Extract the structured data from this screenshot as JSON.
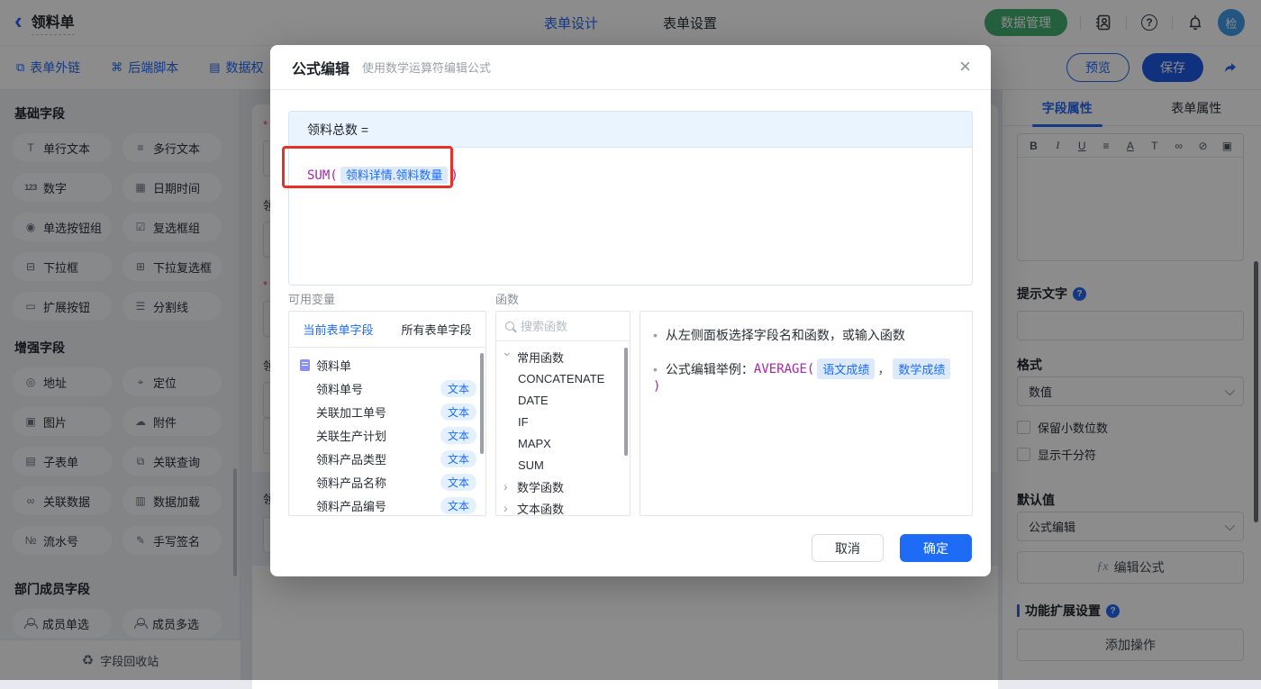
{
  "colors": {
    "accent_blue": "#2468f2",
    "brand_green": "#43ad72",
    "function_purple": "#a626a4",
    "annotation_red": "#e8302a",
    "chip_text": "#1c6cff",
    "chip_bg": "#dceafb"
  },
  "topbar": {
    "back": "‹",
    "title": "领料单",
    "tabs": [
      {
        "label": "表单设计"
      },
      {
        "label": "表单设置"
      }
    ],
    "data_manage_label": "数据管理",
    "help_glyph": "?",
    "avatar_text": "检"
  },
  "subbar": {
    "items": [
      {
        "label": "表单外链",
        "icon": "⧉"
      },
      {
        "label": "后端脚本",
        "icon": "⌘"
      },
      {
        "label": "数据权",
        "icon": "▤"
      }
    ],
    "preview_label": "预览",
    "save_label": "保存"
  },
  "sidebar": {
    "sections": [
      {
        "title": "基础字段",
        "fields": [
          {
            "label": "单行文本",
            "icon": "T"
          },
          {
            "label": "多行文本",
            "icon": "≡"
          },
          {
            "label": "数字",
            "icon": "123"
          },
          {
            "label": "日期时间",
            "icon": "▦"
          },
          {
            "label": "单选按钮组",
            "icon": "◉"
          },
          {
            "label": "复选框组",
            "icon": "☑"
          },
          {
            "label": "下拉框",
            "icon": "⊟"
          },
          {
            "label": "下拉复选框",
            "icon": "⊞"
          },
          {
            "label": "扩展按钮",
            "icon": "▭"
          },
          {
            "label": "分割线",
            "icon": "☰"
          }
        ]
      },
      {
        "title": "增强字段",
        "fields": [
          {
            "label": "地址",
            "icon": "◎"
          },
          {
            "label": "定位",
            "icon": "⌖"
          },
          {
            "label": "图片",
            "icon": "▣"
          },
          {
            "label": "附件",
            "icon": "☁"
          },
          {
            "label": "子表单",
            "icon": "▤"
          },
          {
            "label": "关联查询",
            "icon": "⧉"
          },
          {
            "label": "关联数据",
            "icon": "∞"
          },
          {
            "label": "数据加载",
            "icon": "▥"
          },
          {
            "label": "流水号",
            "icon": "№"
          },
          {
            "label": "手写签名",
            "icon": "✎"
          }
        ]
      },
      {
        "title": "部门成员字段",
        "fields": [
          {
            "label": "成员单选"
          },
          {
            "label": "成员多选"
          }
        ]
      }
    ],
    "recycle_icon": "♻",
    "recycle_label": "字段回收站"
  },
  "canvas": {
    "required_mark": "*",
    "fields": [
      {
        "label": "领",
        "required": true
      },
      {
        "label": "领",
        "required": false
      },
      {
        "label": "领",
        "required": true
      },
      {
        "label": "领",
        "required": false
      },
      {
        "label": "领",
        "required": false
      }
    ]
  },
  "modal": {
    "title": "公式编辑",
    "subtitle": "使用数学运算符编辑公式",
    "close_glyph": "×",
    "formula_target": "领料总数 =",
    "formula_func": "SUM(",
    "formula_chip": "领料详情.领料数量",
    "formula_close": ")",
    "variables_label": "可用变量",
    "variables_tabs": [
      {
        "label": "当前表单字段"
      },
      {
        "label": "所有表单字段"
      }
    ],
    "form_name": "领料单",
    "variable_fields": [
      {
        "name": "领料单号",
        "type": "文本"
      },
      {
        "name": "关联加工单号",
        "type": "文本"
      },
      {
        "name": "关联生产计划",
        "type": "文本"
      },
      {
        "name": "领料产品类型",
        "type": "文本"
      },
      {
        "name": "领料产品名称",
        "type": "文本"
      },
      {
        "name": "领料产品编号",
        "type": "文本"
      }
    ],
    "functions_label": "函数",
    "search_placeholder": "搜索函数",
    "function_groups": [
      {
        "name": "常用函数"
      },
      {
        "name": "数学函数"
      },
      {
        "name": "文本函数"
      }
    ],
    "function_items": [
      {
        "name": "CONCATENATE"
      },
      {
        "name": "DATE"
      },
      {
        "name": "IF"
      },
      {
        "name": "MAPX"
      },
      {
        "name": "SUM"
      }
    ],
    "help_line1": "从左侧面板选择字段名和函数，或输入函数",
    "help_line2_prefix": "公式编辑举例：",
    "help_func": "AVERAGE(",
    "help_chip1": "语文成绩",
    "help_comma": "，",
    "help_chip2": "数学成绩",
    "help_close": ")",
    "cancel_label": "取消",
    "ok_label": "确定"
  },
  "props": {
    "tabs": [
      {
        "label": "字段属性"
      },
      {
        "label": "表单属性"
      }
    ],
    "rte_icons": [
      {
        "name": "bold",
        "glyph": "B"
      },
      {
        "name": "italic",
        "glyph": "I"
      },
      {
        "name": "underline",
        "glyph": "U"
      },
      {
        "name": "align",
        "glyph": "≡"
      },
      {
        "name": "font-color",
        "glyph": "A"
      },
      {
        "name": "font-size",
        "glyph": "T"
      },
      {
        "name": "link",
        "glyph": "∞"
      },
      {
        "name": "unlink",
        "glyph": "⊘"
      },
      {
        "name": "image",
        "glyph": "▣"
      }
    ],
    "hint_label": "提示文字",
    "q_glyph": "?",
    "format_label": "格式",
    "format_value": "数值",
    "decimal_label": "保留小数位数",
    "thousand_label": "显示千分符",
    "default_label": "默认值",
    "default_value": "公式编辑",
    "fx_glyph": "ƒx",
    "edit_formula_label": "编辑公式",
    "ext_label": "功能扩展设置",
    "add_action_label": "添加操作"
  }
}
